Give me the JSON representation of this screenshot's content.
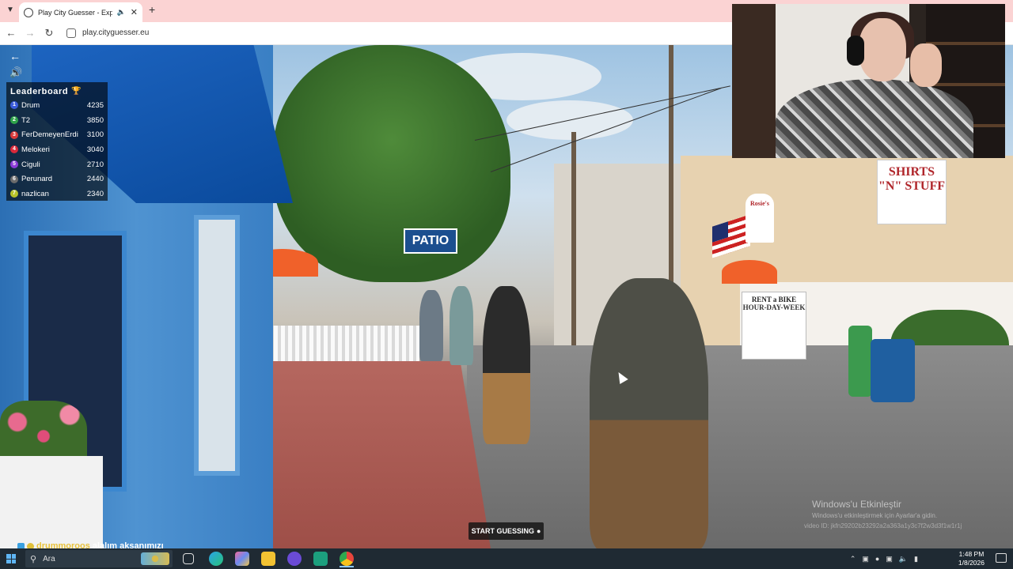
{
  "browser": {
    "tab_title": "Play City Guesser - Explore",
    "new_tab_symbol": "+",
    "url": "play.cityguesser.eu"
  },
  "scene": {
    "signs": {
      "patio": "PATIO",
      "shirts": "SHIRTS \"N\" STUFF",
      "rosies": "Rosie's",
      "bike_title": "RENT a BIKE",
      "bike_sub": "HOUR-DAY-WEEK"
    }
  },
  "leaderboard": {
    "title": "Leaderboard",
    "entries": [
      {
        "rank": "1",
        "name": "Drum",
        "score": "4235",
        "color": "#3a5bd9"
      },
      {
        "rank": "2",
        "name": "T2",
        "score": "3850",
        "color": "#2fa34a"
      },
      {
        "rank": "3",
        "name": "FerDemeyenErdi",
        "score": "3100",
        "color": "#d93a3a"
      },
      {
        "rank": "4",
        "name": "Melokeri",
        "score": "3040",
        "color": "#d9293a"
      },
      {
        "rank": "5",
        "name": "Ciguli",
        "score": "2710",
        "color": "#8a3ad9"
      },
      {
        "rank": "6",
        "name": "Perunard",
        "score": "2440",
        "color": "#6b6b6b"
      },
      {
        "rank": "7",
        "name": "nazlican",
        "score": "2340",
        "color": "#b8c42a"
      }
    ]
  },
  "game": {
    "start_button": "START GUESSING",
    "activation_title": "Windows'u Etkinleştir",
    "activation_sub": "Windows'u etkinleştirmek için Ayarlar'a gidin.",
    "video_id": "video ID: jkfn29202b23292a2a363a1y3c7f2w3d3f1w1r1j"
  },
  "chat": {
    "user": "drummoroos",
    "message": "alalım aksanımızı"
  },
  "taskbar": {
    "search_placeholder": "Ara",
    "time": "1:48 PM",
    "date": "1/8/2026"
  }
}
